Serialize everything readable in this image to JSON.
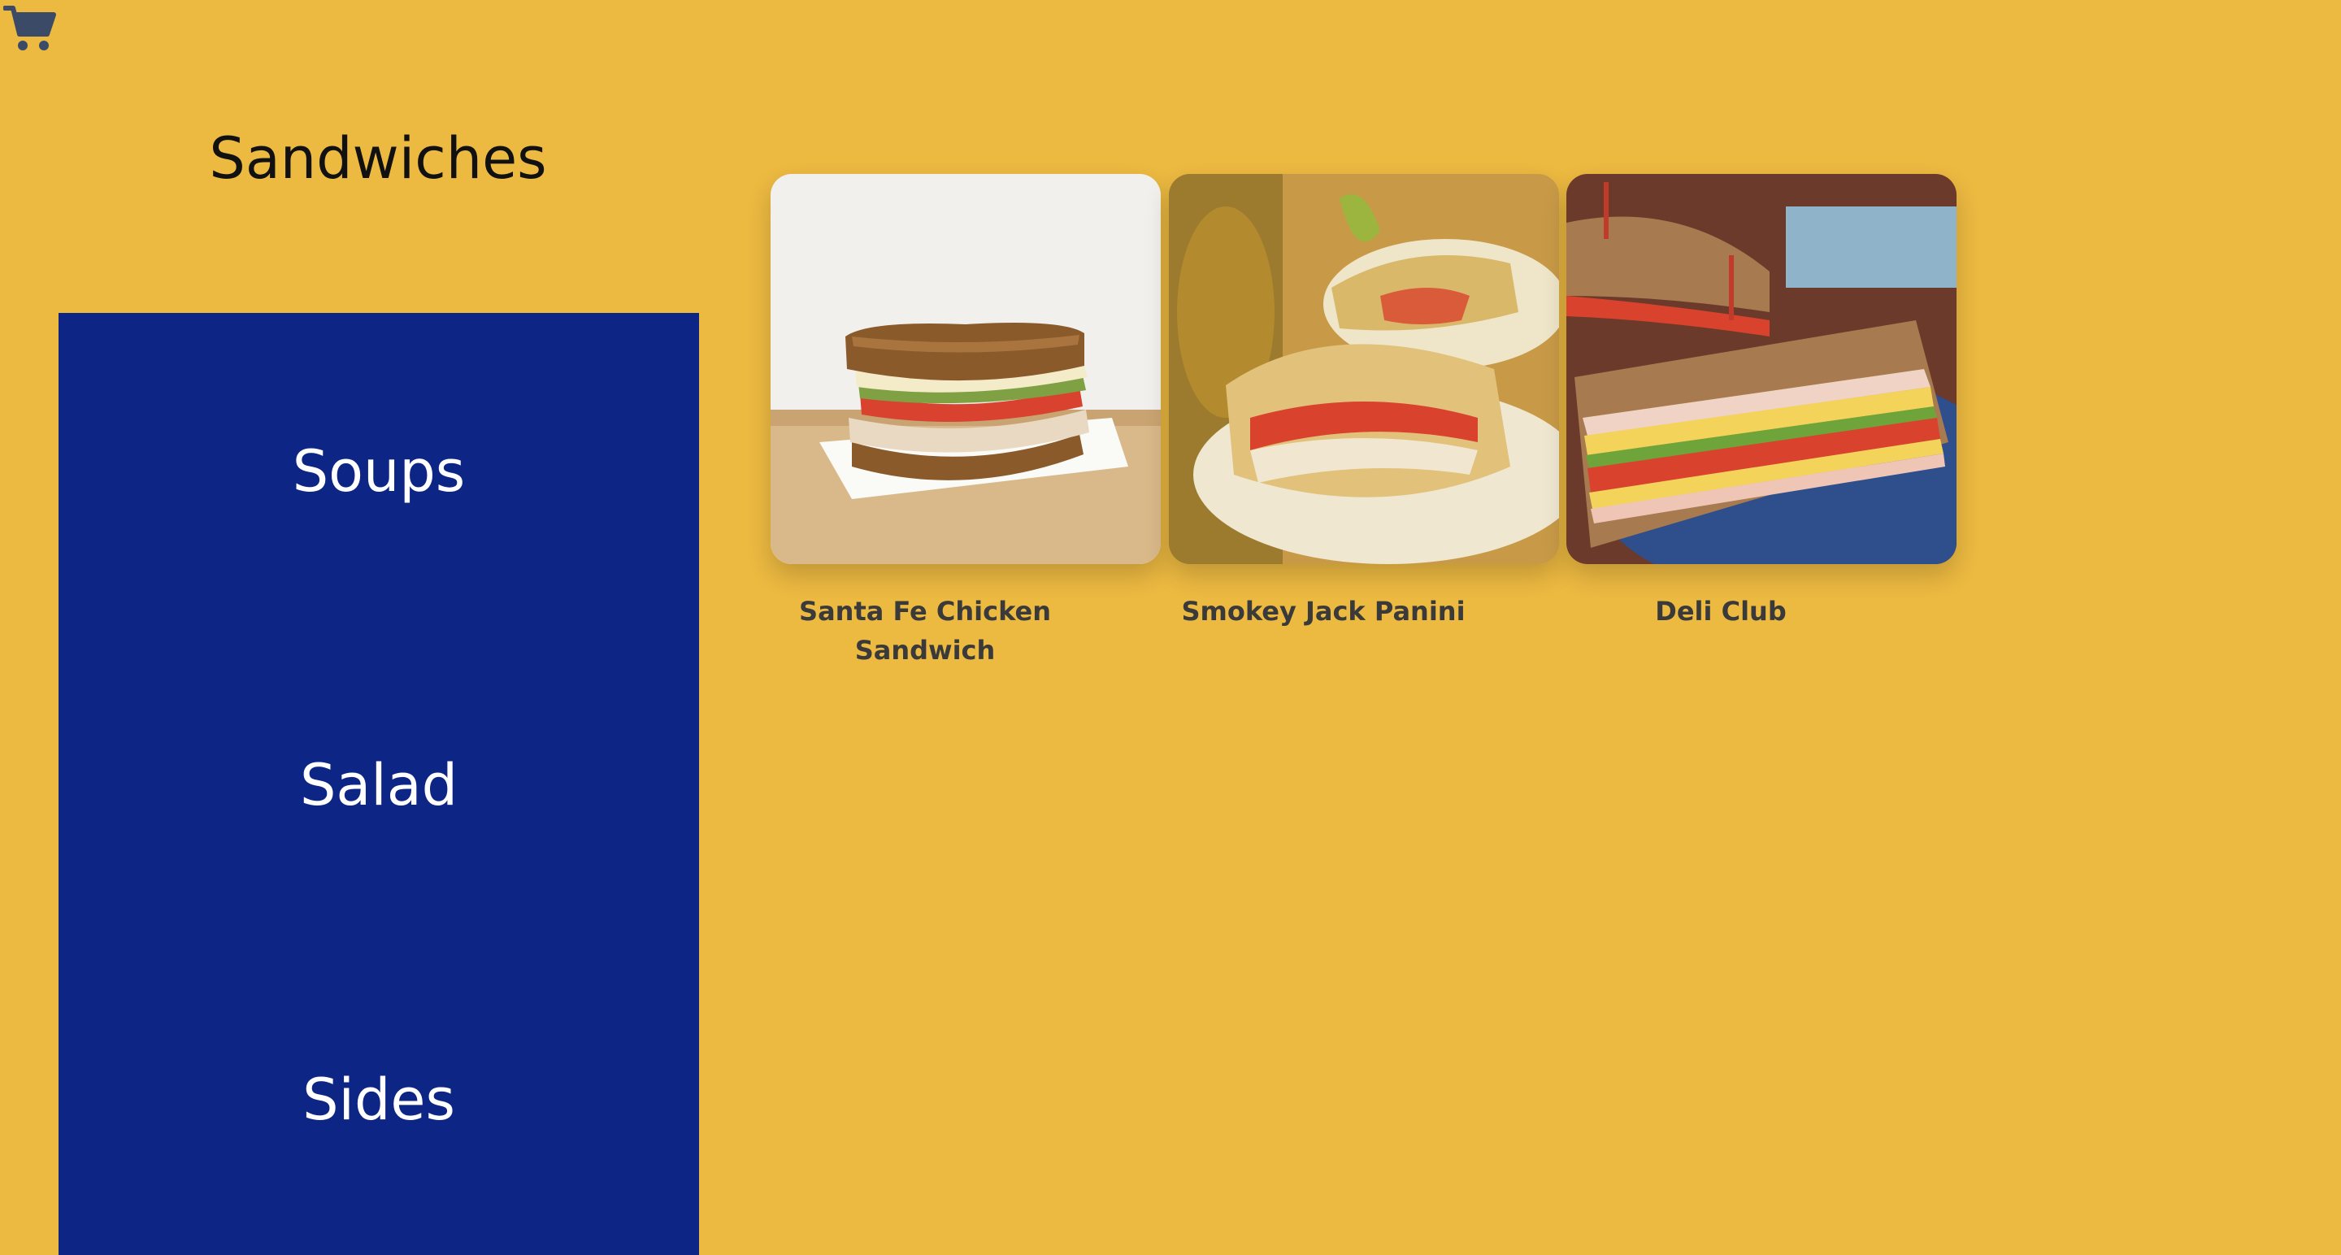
{
  "header": {
    "cart_icon": "shopping-cart-icon"
  },
  "category": {
    "title": "Sandwiches"
  },
  "nav": {
    "items": [
      {
        "label": "Soups"
      },
      {
        "label": "Salad"
      },
      {
        "label": "Sides"
      }
    ]
  },
  "products": [
    {
      "name": "Santa Fe Chicken Sandwich",
      "image": "sandwich-photo"
    },
    {
      "name": "Smokey Jack Panini",
      "image": "panini-photo"
    },
    {
      "name": "Deli Club",
      "image": "club-sandwich-photo"
    }
  ],
  "colors": {
    "background": "#ECB941",
    "nav_background": "#0D2585",
    "nav_text": "#FFFFFF",
    "product_name_text": "#3A3A3A",
    "cart_icon": "#3B4A66"
  }
}
